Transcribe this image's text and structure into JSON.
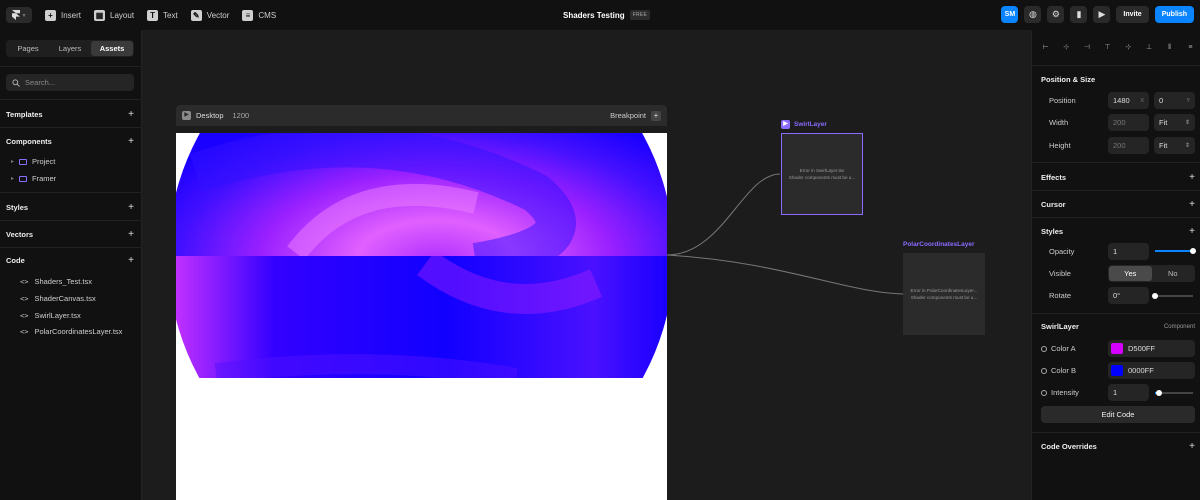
{
  "topbar": {
    "items": [
      {
        "label": "Insert",
        "icon": "plus-square-icon"
      },
      {
        "label": "Layout",
        "icon": "layout-icon"
      },
      {
        "label": "Text",
        "icon": "text-icon"
      },
      {
        "label": "Vector",
        "icon": "pen-icon"
      },
      {
        "label": "CMS",
        "icon": "database-icon"
      }
    ],
    "project_title": "Shaders Testing",
    "plan_badge": "FREE",
    "avatar_initials": "SM",
    "invite_label": "Invite",
    "publish_label": "Publish"
  },
  "left_panel": {
    "tabs": [
      "Pages",
      "Layers",
      "Assets"
    ],
    "active_tab": "Assets",
    "search_placeholder": "Search...",
    "sections": {
      "templates": "Templates",
      "components": "Components",
      "styles": "Styles",
      "vectors": "Vectors",
      "code": "Code"
    },
    "components": [
      "Project",
      "Framer"
    ],
    "code_files": [
      "Shaders_Test.tsx",
      "ShaderCanvas.tsx",
      "SwirlLayer.tsx",
      "PolarCoordinatesLayer.tsx"
    ]
  },
  "canvas": {
    "frame_label": "Desktop",
    "frame_width": "1200",
    "breakpoint_label": "Breakpoint",
    "swirl_node": {
      "title": "SwirlLayer",
      "error_line1": "Error in SwirlLayer.tsx",
      "error_line2": "Shader components must be u..."
    },
    "polar_node": {
      "title": "PolarCoordinatesLayer",
      "error_line1": "Error in PolarCoordinatesLayer...",
      "error_line2": "Shader components must be u..."
    }
  },
  "right_panel": {
    "position_size": {
      "title": "Position & Size",
      "position_label": "Position",
      "x_value": "1480",
      "x_hint": "X",
      "y_value": "0",
      "y_hint": "Y",
      "width_label": "Width",
      "width_value": "200",
      "width_mode": "Fit",
      "height_label": "Height",
      "height_value": "200",
      "height_mode": "Fit"
    },
    "effects_title": "Effects",
    "cursor_title": "Cursor",
    "styles": {
      "title": "Styles",
      "opacity_label": "Opacity",
      "opacity_value": "1",
      "opacity_level": 1.0,
      "visible_label": "Visible",
      "visible_yes": "Yes",
      "visible_no": "No",
      "rotate_label": "Rotate",
      "rotate_value": "0°",
      "rotate_level": 0.0
    },
    "component": {
      "title": "SwirlLayer",
      "kind": "Component",
      "color_a_label": "Color A",
      "color_a_value": "D500FF",
      "color_a_hex": "#D500FF",
      "color_b_label": "Color B",
      "color_b_value": "0000FF",
      "color_b_hex": "#0000FF",
      "intensity_label": "Intensity",
      "intensity_value": "1",
      "intensity_level": 0.1,
      "edit_code_label": "Edit Code"
    },
    "code_overrides_title": "Code Overrides"
  }
}
